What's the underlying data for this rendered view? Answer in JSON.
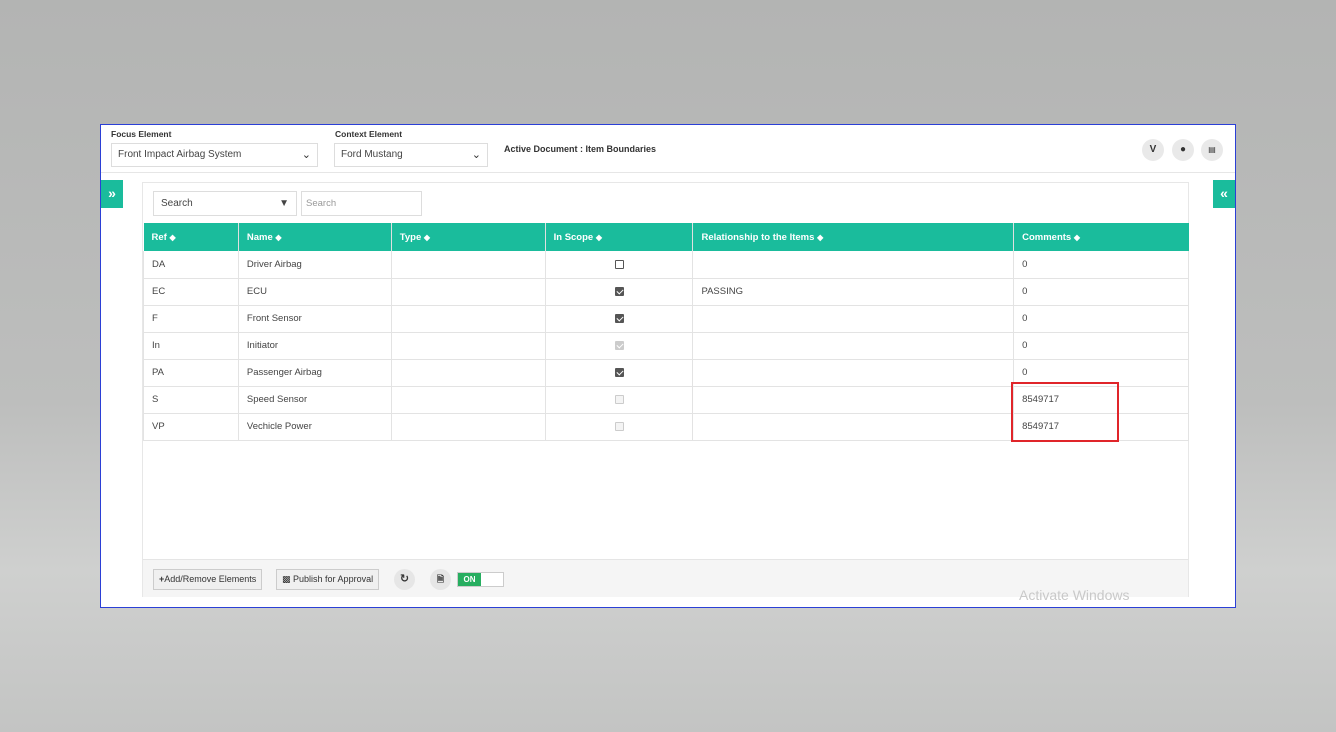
{
  "header": {
    "focus_label": "Focus Element",
    "focus_value": "Front Impact Airbag System",
    "context_label": "Context Element",
    "context_value": "Ford Mustang",
    "active_doc_label": "Active Document :",
    "active_doc_value": "Item Boundaries",
    "icons": [
      "vine-icon",
      "drop-icon",
      "chart-icon"
    ]
  },
  "toolbar": {
    "search_select": "Search",
    "search_placeholder": "Search"
  },
  "table": {
    "columns": [
      "Ref",
      "Name",
      "Type",
      "In Scope",
      "Relationship to the Items",
      "Comments"
    ],
    "rows": [
      {
        "ref": "DA",
        "name": "Driver Airbag",
        "type": "",
        "in_scope": "unchecked",
        "relationship": "",
        "comments": "0"
      },
      {
        "ref": "EC",
        "name": "ECU",
        "type": "",
        "in_scope": "checked",
        "relationship": "PASSING",
        "comments": "0"
      },
      {
        "ref": "F",
        "name": "Front Sensor",
        "type": "",
        "in_scope": "checked",
        "relationship": "",
        "comments": "0"
      },
      {
        "ref": "In",
        "name": "Initiator",
        "type": "",
        "in_scope": "checked-disabled",
        "relationship": "",
        "comments": "0"
      },
      {
        "ref": "PA",
        "name": "Passenger Airbag",
        "type": "",
        "in_scope": "checked",
        "relationship": "",
        "comments": "0"
      },
      {
        "ref": "S",
        "name": "Speed Sensor",
        "type": "",
        "in_scope": "disabled",
        "relationship": "",
        "comments": "8549717"
      },
      {
        "ref": "VP",
        "name": "Vechicle Power",
        "type": "",
        "in_scope": "disabled",
        "relationship": "",
        "comments": "8549717"
      }
    ]
  },
  "footer": {
    "add_remove": "Add/Remove Elements",
    "publish": "Publish for Approval",
    "toggle": "ON"
  },
  "watermark": "Activate Windows",
  "colors": {
    "accent": "#1abc9c",
    "toggle_on": "#27ae60",
    "highlight": "#e0252a",
    "frame": "#2b3fd6"
  }
}
